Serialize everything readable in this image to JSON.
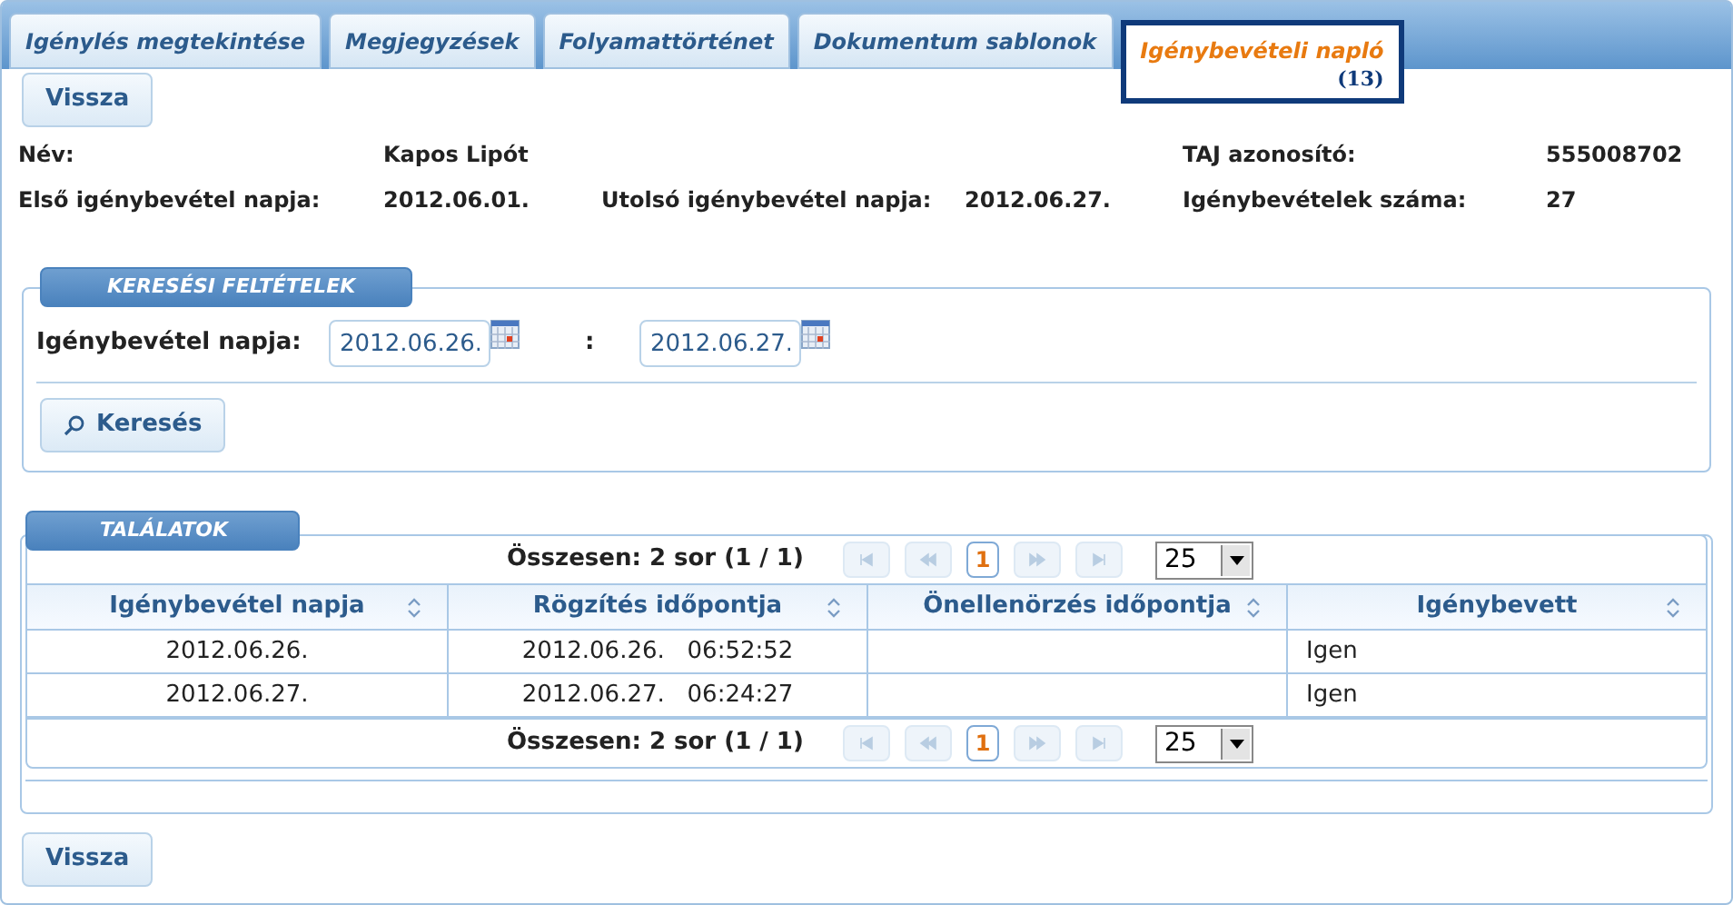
{
  "tabs": [
    {
      "label": "Igénylés megtekintése",
      "selected": false
    },
    {
      "label": "Megjegyzések",
      "selected": false
    },
    {
      "label": "Folyamattörténet",
      "selected": false
    },
    {
      "label": "Dokumentum sablonok",
      "selected": false
    },
    {
      "label": "Igénybevételi napló",
      "selected": true,
      "count": "(13)"
    }
  ],
  "back_button_top": "Vissza",
  "info": [
    {
      "label": "Név:",
      "value": "Kapos Lipót"
    },
    {
      "label": "TAJ azonosító:",
      "value": "555008702"
    },
    {
      "label": "Első igénybevétel napja:",
      "value": "2012.06.01."
    },
    {
      "label": "Utolsó igénybevétel napja:",
      "value": "2012.06.27."
    },
    {
      "label": "Igénybevételek száma:",
      "value": "27"
    }
  ],
  "search": {
    "legend": "KERESÉSI FELTÉTELEK",
    "label": "Igénybevétel napja:",
    "from": "2012.06.26.",
    "separator": ":",
    "to": "2012.06.27.",
    "button": "Keresés"
  },
  "results": {
    "legend": "TALÁLATOK",
    "paginator_top": {
      "summary": "Összesen: 2 sor (1 / 1)",
      "first_disabled": true,
      "prev_disabled": true,
      "pages": [
        {
          "label": "1",
          "selected": true
        }
      ],
      "next_disabled": true,
      "last_disabled": true,
      "page_size": "25"
    },
    "columns": [
      "Igénybevétel napja",
      "Rögzítés időpontja",
      "Önellenörzés időpontja",
      "Igénybevett"
    ],
    "rows": [
      [
        "2012.06.26.",
        "2012.06.26.   06:52:52",
        "",
        "Igen"
      ],
      [
        "2012.06.27.",
        "2012.06.27.   06:24:27",
        "",
        "Igen"
      ]
    ],
    "paginator_bottom": {
      "summary": "Összesen: 2 sor (1 / 1)",
      "first_disabled": true,
      "prev_disabled": true,
      "pages": [
        {
          "label": "1",
          "selected": true
        }
      ],
      "next_disabled": true,
      "last_disabled": true,
      "page_size": "25"
    }
  },
  "back_button_bottom": "Vissza"
}
